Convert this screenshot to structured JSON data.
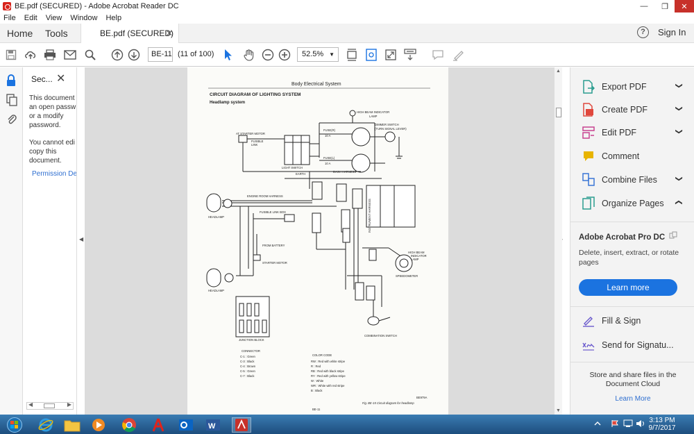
{
  "window": {
    "title": "BE.pdf (SECURED) - Adobe Acrobat Reader DC"
  },
  "menu": [
    "File",
    "Edit",
    "View",
    "Window",
    "Help"
  ],
  "nav": {
    "home": "Home",
    "tools": "Tools",
    "tab": "BE.pdf (SECURED)",
    "help": "?",
    "signin": "Sign In"
  },
  "toolbar": {
    "page_label": "BE-11",
    "page_count": "(11 of 100)",
    "zoom": "52.5%"
  },
  "security": {
    "title": "Sec...",
    "lines": [
      "This document",
      "an open passw",
      "or a modify",
      "password.",
      "You cannot edi",
      "copy this",
      "document."
    ],
    "link": "Permission De"
  },
  "doc": {
    "header": "Body Electrical System",
    "title": "CIRCUIT DIAGRAM OF LIGHTING SYSTEM",
    "subtitle": "Headlamp system",
    "labels": {
      "hb_lamp": "HIGH BEAM INDICATOR",
      "hb_lamp2": "LAMP",
      "dimmer": "DIMMER SWITCH",
      "turn": "(TURN SIGNAL LEVER)",
      "starter_top": "AT STARTER MOTOR",
      "fusible": "FUSIBLE",
      "link": "LINK",
      "fuse_r": "FUSE(R)",
      "fuse_r_amp": "10 A",
      "fuse_l": "FUSE(L)",
      "fuse_l_amp": "10 A",
      "light_switch": "LIGHT SWITCH",
      "earth": "EARTH",
      "dash": "DASH HARNESS",
      "engine_room": "ENGINE ROOM HARNESS",
      "fusible_box": "FUSIBLE LINK BOX",
      "headlamp1": "HEADLAMP",
      "headlamp2": "HEADLAMP",
      "instrument": "INSTRUMENT HARNESS",
      "from_battery": "FROM BATTERY",
      "starter_motor": "STARTER MOTOR",
      "hb_indicator": "HIGH BEAM",
      "hb_indicator2": "INDICATOR",
      "hb_indicator3": "LAMP",
      "speedometer": "SPEEDOMETER",
      "junction": "JUNCTION BLOCK",
      "combination": "COMBINATION SWITCH",
      "connector": "CONNECTOR",
      "color_code": "COLOR CODE",
      "code": "BE979A",
      "figure": "Fig. BE-15  Circuit diagram for headlamp",
      "page": "BE-11"
    },
    "connectors": [
      "C-1  : Green",
      "C-3  : Black",
      "C-4  : Brown",
      "C-5  : Green",
      "C-7  : Black"
    ],
    "colors": [
      "RW : Red with white stripe",
      "R    : Red",
      "RB  : Red with black stripe",
      "RY  : Red with yellow stripe",
      "W    : White",
      "WR  : White with red stripe",
      "B    : Black"
    ]
  },
  "right_tools": [
    {
      "label": "Export PDF",
      "chevron": "down",
      "color": "#2a9d8f"
    },
    {
      "label": "Create PDF",
      "chevron": "down",
      "color": "#e0473c"
    },
    {
      "label": "Edit PDF",
      "chevron": "down",
      "color": "#c8428f"
    },
    {
      "label": "Comment",
      "chevron": "",
      "color": "#e8b400"
    },
    {
      "label": "Combine Files",
      "chevron": "down",
      "color": "#3b76d6"
    },
    {
      "label": "Organize Pages",
      "chevron": "up",
      "color": "#2a9d8f"
    }
  ],
  "promo": {
    "title": "Adobe Acrobat Pro DC",
    "desc": "Delete, insert, extract, or rotate pages",
    "button": "Learn more"
  },
  "bottom_tools": [
    {
      "label": "Fill & Sign",
      "color": "#6a5acd"
    },
    {
      "label": "Send for Signatu...",
      "color": "#6a5acd"
    }
  ],
  "store": {
    "text": "Store and share files in the Document Cloud",
    "link": "Learn More"
  },
  "clock": {
    "time": "3:13 PM",
    "date": "9/7/2017"
  }
}
